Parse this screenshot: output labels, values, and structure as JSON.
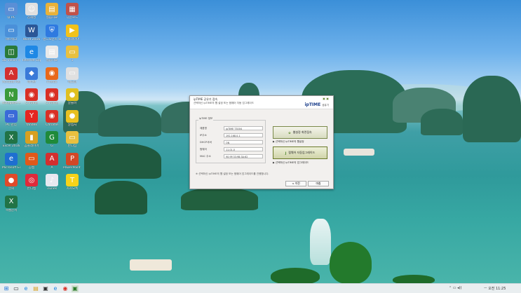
{
  "desktop": {
    "icons": [
      {
        "label": "내 PC",
        "glyph": "▭",
        "color": "#5a8fd6"
      },
      {
        "label": "김혜성",
        "glyph": "☺",
        "color": "#e0e0e0"
      },
      {
        "label": "실습자료",
        "glyph": "▤",
        "color": "#e8b23a"
      },
      {
        "label": "다운로드",
        "glyph": "▦",
        "color": "#c0524a"
      },
      {
        "label": "네트워크",
        "glyph": "▭",
        "color": "#4a90d9"
      },
      {
        "label": "Word 2016",
        "glyph": "W",
        "color": "#2b5797"
      },
      {
        "label": "엔드포인트 보안",
        "glyph": "⛨",
        "color": "#2f7ae0"
      },
      {
        "label": "팟플레이어",
        "glyph": "▶",
        "color": "#f2c21a"
      },
      {
        "label": "3D Vision 사진 뷰어",
        "glyph": "◫",
        "color": "#2a7a3a"
      },
      {
        "label": "Internet Explorer",
        "glyph": "e",
        "color": "#1e88e5"
      },
      {
        "label": "실습자료",
        "glyph": "▤",
        "color": "#e9e9e9"
      },
      {
        "label": "1",
        "glyph": "▭",
        "color": "#e8c040"
      },
      {
        "label": "Acrobat Reader DC",
        "glyph": "A",
        "color": "#d32f2f"
      },
      {
        "label": "제어판",
        "glyph": "◆",
        "color": "#3a7ad8"
      },
      {
        "label": "Firefox",
        "glyph": "◉",
        "color": "#e8681a"
      },
      {
        "label": "메모장",
        "glyph": "▭",
        "color": "#e0e0e0"
      },
      {
        "label": "Notepad++",
        "glyph": "N",
        "color": "#3a9a3a"
      },
      {
        "label": "Chrome",
        "glyph": "◉",
        "color": "#d93025"
      },
      {
        "label": "Chrome",
        "glyph": "◉",
        "color": "#d93025"
      },
      {
        "label": "알툴바",
        "glyph": "●",
        "color": "#e0c020"
      },
      {
        "label": "PC 관리",
        "glyph": "▭",
        "color": "#3a6ad8"
      },
      {
        "label": "Yandex",
        "glyph": "Y",
        "color": "#e52620"
      },
      {
        "label": "Chrome",
        "glyph": "◉",
        "color": "#d93025"
      },
      {
        "label": "알캡처",
        "glyph": "●",
        "color": "#e8c020"
      },
      {
        "label": "Excel 2016",
        "glyph": "X",
        "color": "#217346"
      },
      {
        "label": "곰플레이어",
        "glyph": "▮",
        "color": "#d8a020"
      },
      {
        "label": "G",
        "glyph": "G",
        "color": "#1f8a3a"
      },
      {
        "label": "반디집",
        "glyph": "▭",
        "color": "#e8c040"
      },
      {
        "label": "Microsoft Edge",
        "glyph": "e",
        "color": "#1e6fd0"
      },
      {
        "label": "곰캠",
        "glyph": "▭",
        "color": "#e0581a"
      },
      {
        "label": "A",
        "glyph": "A",
        "color": "#d32f2f"
      },
      {
        "label": "PowerPoint 2016",
        "glyph": "P",
        "color": "#d24726"
      },
      {
        "label": "알씨",
        "glyph": "●",
        "color": "#e04a2a"
      },
      {
        "label": "반디캠",
        "glyph": "◎",
        "color": "#e02a3a"
      },
      {
        "label": "iTunes",
        "glyph": "♪",
        "color": "#e8e8f0"
      },
      {
        "label": "카카오톡",
        "glyph": "T",
        "color": "#f7d31a"
      },
      {
        "label": "엑셀문서",
        "glyph": "X",
        "color": "#217346"
      }
    ]
  },
  "dialog": {
    "title": "ipTIME 공유기 접속",
    "subtitle": "선택하신 ipTIME의 웹 설정 또는 펌웨어 자동 업그레이드",
    "logo": "ipTIME",
    "logo_sub": "공유기",
    "group_title": "ipTIME 정보",
    "fields": [
      {
        "label": "제품명",
        "value": "ipTIME T3004"
      },
      {
        "label": "IP주소",
        "value": "192.168.0.1"
      },
      {
        "label": "DHCP서버",
        "value": "ON"
      },
      {
        "label": "펌웨어",
        "value": "11.01.0"
      },
      {
        "label": "MAC 주소",
        "value": "90:9F:33:9B:3A:62"
      }
    ],
    "web_button": "웹설정 화면접속",
    "web_link": "▶ 선택하신 ipTIME의 웹설정",
    "fw_button": "펌웨어 자동업그레이드",
    "fw_link": "▶ 선택하신 ipTIME의 업그레이드",
    "note": "※ 선택하신 ipTIME의 웹 설정 또는 펌웨어 업그레이드를 진행합니다.",
    "back_button": "< 이전",
    "next_button": "마침"
  },
  "taskbar": {
    "tray_text": "ㅡ 오전 11:25"
  }
}
